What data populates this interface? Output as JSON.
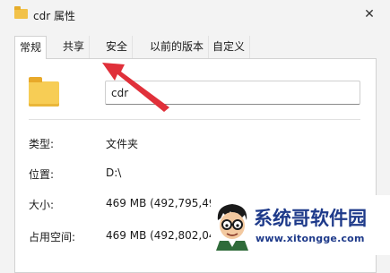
{
  "window": {
    "title": "cdr 属性",
    "close_glyph": "✕",
    "title_icon": "folder-icon"
  },
  "tabs": [
    {
      "label": "常规",
      "active": true
    },
    {
      "label": "共享",
      "active": false
    },
    {
      "label": "安全",
      "active": false
    },
    {
      "label": "以前的版本",
      "active": false
    },
    {
      "label": "自定义",
      "active": false
    }
  ],
  "general": {
    "folder_name": "cdr",
    "properties": [
      {
        "label": "类型:",
        "value": "文件夹"
      },
      {
        "label": "位置:",
        "value": "D:\\"
      },
      {
        "label": "大小:",
        "value": "469 MB (492,795,49"
      },
      {
        "label": "占用空间:",
        "value": "469 MB (492,802,04"
      }
    ]
  },
  "annotation": {
    "type": "arrow",
    "color": "#e0303a",
    "points_to": "tab-share"
  },
  "watermark": {
    "title": "系统哥软件园",
    "url": "www.xitongge.com",
    "color": "#1e3a8a"
  }
}
